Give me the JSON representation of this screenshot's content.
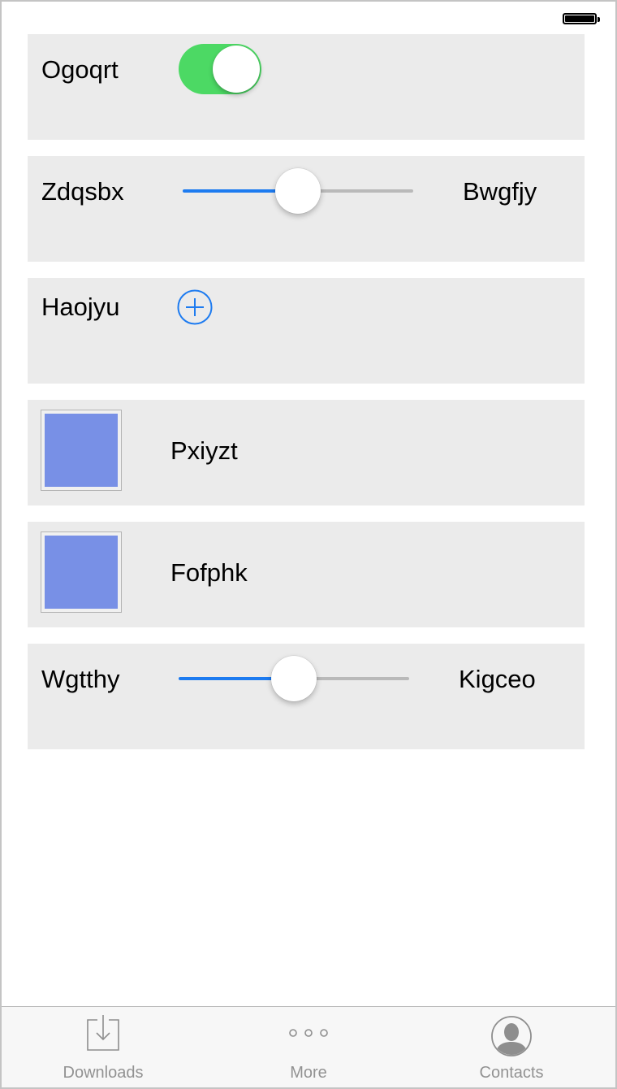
{
  "status_bar": {
    "battery_icon": "battery-full-icon"
  },
  "rows": {
    "toggle_row": {
      "label": "Ogoqrt",
      "switch_on": true,
      "switch_color": "#4cd964"
    },
    "slider_row_1": {
      "min_label": "Zdqsbx",
      "max_label": "Bwgfjy",
      "value_fraction": 0.5
    },
    "add_row": {
      "label": "Haojyu",
      "icon": "add-circle-icon"
    },
    "swatch_row_1": {
      "label": "Pxiyzt",
      "color": "#7890e6"
    },
    "swatch_row_2": {
      "label": "Fofphk",
      "color": "#7890e6"
    },
    "slider_row_2": {
      "min_label": "Wgtthy",
      "max_label": "Kigceo",
      "value_fraction": 0.5
    }
  },
  "accent_color": "#1d7bf0",
  "tabbar": {
    "tabs": [
      {
        "label": "Downloads",
        "icon": "download-tray-icon"
      },
      {
        "label": "More",
        "icon": "more-dots-icon"
      },
      {
        "label": "Contacts",
        "icon": "contact-avatar-icon"
      }
    ]
  }
}
